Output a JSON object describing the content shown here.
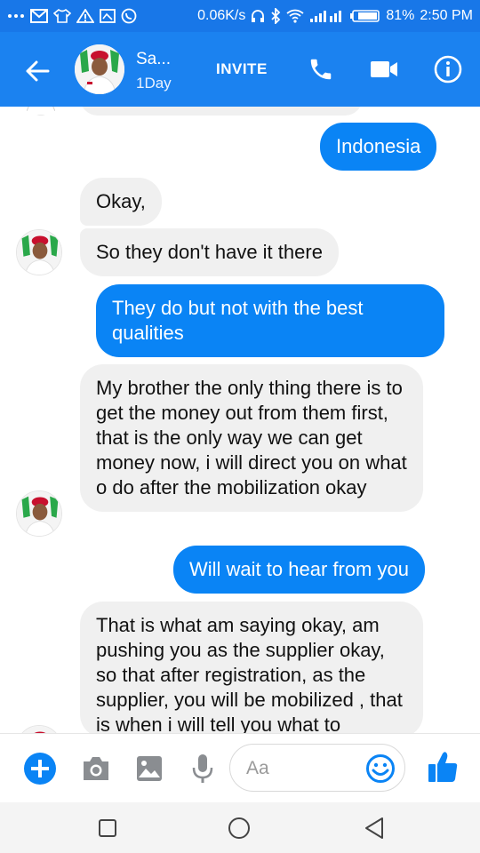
{
  "status_bar": {
    "net_speed": "0.06K/s",
    "battery": "81%",
    "time": "2:50 PM"
  },
  "header": {
    "contact_name": "Sa...",
    "contact_status": "1Day",
    "invite_label": "INVITE"
  },
  "messages": [
    {
      "direction": "outgoing",
      "text": "Indonesia"
    },
    {
      "direction": "incoming",
      "text": "Okay,"
    },
    {
      "direction": "incoming",
      "text": "So they don't have it there"
    },
    {
      "direction": "outgoing",
      "text": "They do but not with the best qualities"
    },
    {
      "direction": "incoming",
      "text": "My brother the only thing there is to get the money out from them first, that is the only way we can get money now, i will direct you on what o do after the mobilization okay"
    },
    {
      "direction": "outgoing",
      "text": "Will wait to hear from you"
    },
    {
      "direction": "incoming",
      "text": "That is what am saying okay, am pushing you as the supplier okay, so that after registration, as the supplier, you will be mobilized , that is when i will tell you what to"
    }
  ],
  "composer": {
    "placeholder": "Aa"
  },
  "colors": {
    "header_blue": "#1b82f0",
    "outgoing_bubble": "#0a84f5",
    "incoming_bubble": "#f0f0f0"
  },
  "icons": {
    "back": "arrow-left-icon",
    "call": "phone-icon",
    "video": "video-camera-icon",
    "info": "info-icon",
    "add": "plus-icon",
    "camera": "camera-icon",
    "gallery": "image-icon",
    "mic": "microphone-icon",
    "emoji": "smiley-icon",
    "like": "thumbs-up-icon"
  }
}
